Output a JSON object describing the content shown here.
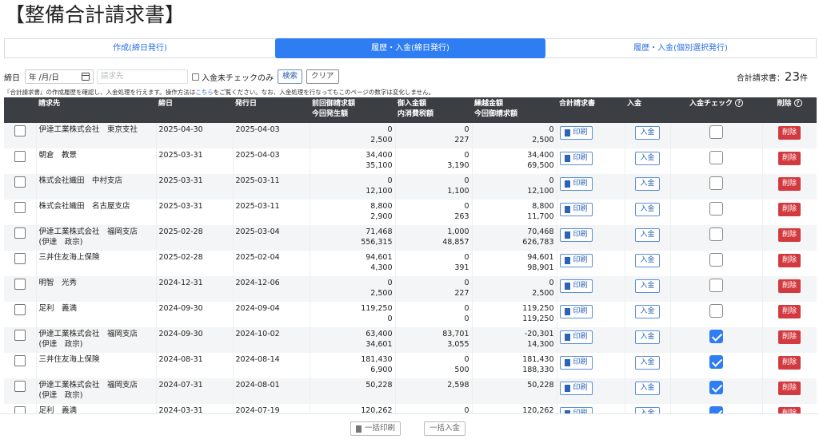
{
  "page_title": "【整備合計請求書】",
  "tabs": [
    {
      "label": "作成(締日発行)",
      "active": false
    },
    {
      "label": "履歴・入金(締日発行)",
      "active": true
    },
    {
      "label": "履歴・入金(個別選択発行)",
      "active": false
    }
  ],
  "filter": {
    "closing_date_label": "締日",
    "date_value": "年 /月/日",
    "billing_placeholder": "請求先",
    "unpaid_check_label": "入金未チェックのみ",
    "search_label": "検索",
    "clear_label": "クリア"
  },
  "total": {
    "label": "合計請求書：",
    "count": "23",
    "unit": "件"
  },
  "note": {
    "before": "『合計請求書』の作成履歴を確認し、入金処理を行えます。操作方法は",
    "link": "こちら",
    "after": "をご覧ください。なお、入金処理を行なってもこのページの数字は変化しません。"
  },
  "table": {
    "headers": {
      "billing_to": "請求先",
      "closing_date": "締日",
      "issue_date": "発行日",
      "prev_amount_1": "前回御請求額",
      "prev_amount_2": "今回発生額",
      "payment_1": "御入金額",
      "payment_2": "内消費税額",
      "carryover_1": "繰越金額",
      "carryover_2": "今回御請求額",
      "invoice": "合計請求書",
      "deposit": "入金",
      "deposit_check": "入金チェック",
      "delete": "削除"
    },
    "print_label": "印刷",
    "deposit_label": "入金",
    "delete_label": "削除",
    "rows": [
      {
        "name1": "伊達工業株式会社　東京支社",
        "name2": "",
        "closing": "2025-04-30",
        "issued": "2025-04-03",
        "a1": "0",
        "a2": "2,500",
        "b1": "0",
        "b2": "227",
        "c1": "0",
        "c2": "2,500",
        "checked": false
      },
      {
        "name1": "朝倉　教景",
        "name2": "",
        "closing": "2025-03-31",
        "issued": "2025-04-03",
        "a1": "34,400",
        "a2": "35,100",
        "b1": "0",
        "b2": "3,190",
        "c1": "34,400",
        "c2": "69,500",
        "checked": false
      },
      {
        "name1": "株式会社織田　中村支店",
        "name2": "",
        "closing": "2025-03-31",
        "issued": "2025-03-11",
        "a1": "0",
        "a2": "12,100",
        "b1": "0",
        "b2": "1,100",
        "c1": "0",
        "c2": "12,100",
        "checked": false
      },
      {
        "name1": "株式会社織田　名古屋支店",
        "name2": "",
        "closing": "2025-03-31",
        "issued": "2025-03-11",
        "a1": "8,800",
        "a2": "2,900",
        "b1": "0",
        "b2": "263",
        "c1": "8,800",
        "c2": "11,700",
        "checked": false
      },
      {
        "name1": "伊達工業株式会社　福岡支店",
        "name2": "(伊達　政宗)",
        "closing": "2025-02-28",
        "issued": "2025-03-04",
        "a1": "71,468",
        "a2": "556,315",
        "b1": "1,000",
        "b2": "48,857",
        "c1": "70,468",
        "c2": "626,783",
        "checked": false
      },
      {
        "name1": "三井住友海上保険",
        "name2": "",
        "closing": "2025-02-28",
        "issued": "2025-02-04",
        "a1": "94,601",
        "a2": "4,300",
        "b1": "0",
        "b2": "391",
        "c1": "94,601",
        "c2": "98,901",
        "checked": false
      },
      {
        "name1": "明智　光秀",
        "name2": "",
        "closing": "2024-12-31",
        "issued": "2024-12-06",
        "a1": "0",
        "a2": "2,500",
        "b1": "0",
        "b2": "227",
        "c1": "0",
        "c2": "2,500",
        "checked": false
      },
      {
        "name1": "足利　義満",
        "name2": "",
        "closing": "2024-09-30",
        "issued": "2024-09-04",
        "a1": "119,250",
        "a2": "0",
        "b1": "0",
        "b2": "0",
        "c1": "119,250",
        "c2": "119,250",
        "checked": false
      },
      {
        "name1": "伊達工業株式会社　福岡支店",
        "name2": "(伊達　政宗)",
        "closing": "2024-09-30",
        "issued": "2024-10-02",
        "a1": "63,400",
        "a2": "34,601",
        "b1": "83,701",
        "b2": "3,055",
        "c1": "-20,301",
        "c2": "14,300",
        "checked": true
      },
      {
        "name1": "三井住友海上保険",
        "name2": "",
        "closing": "2024-08-31",
        "issued": "2024-08-14",
        "a1": "181,430",
        "a2": "6,900",
        "b1": "0",
        "b2": "500",
        "c1": "181,430",
        "c2": "188,330",
        "checked": true
      },
      {
        "name1": "伊達工業株式会社　福岡支店",
        "name2": "(伊達　政宗)",
        "closing": "2024-07-31",
        "issued": "2024-08-01",
        "a1": "",
        "a2": "50,228",
        "b1": "",
        "b2": "2,598",
        "c1": "",
        "c2": "50,228",
        "checked": true
      },
      {
        "name1": "足利　義満",
        "name2": "",
        "closing": "2024-03-31",
        "issued": "2024-07-19",
        "a1": "120,262",
        "a2": "",
        "b1": "0",
        "b2": "",
        "c1": "120,262",
        "c2": "",
        "checked": true
      }
    ]
  },
  "footer": {
    "bulk_print_label": "一括印刷",
    "bulk_deposit_label": "一括入金"
  }
}
